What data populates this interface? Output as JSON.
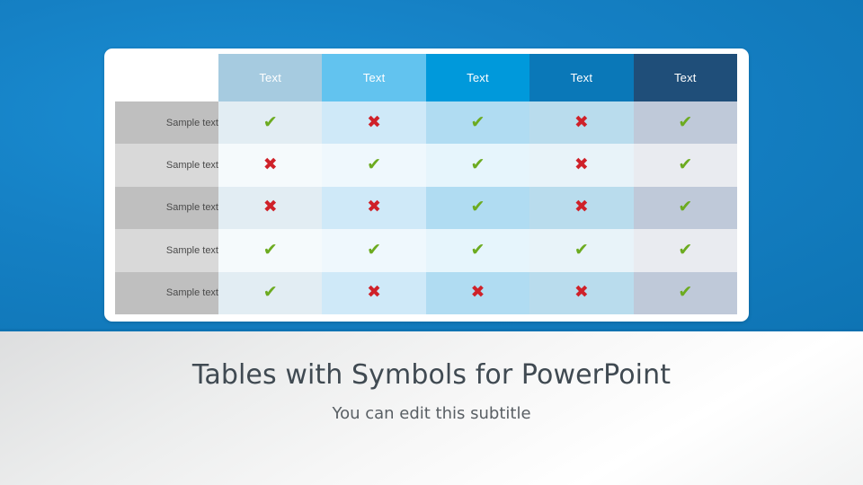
{
  "slide": {
    "title": "Tables with Symbols for PowerPoint",
    "subtitle": "You can edit this subtitle"
  },
  "colors": {
    "background_blue": "#1580c4",
    "background_light": "#f2f3f3",
    "card": "#ffffff",
    "check": "#6cab20",
    "cross": "#cf2129",
    "row_label_dark": "#bfbfbf",
    "row_label_light": "#d9d9d9",
    "title_text": "#404a52",
    "subtitle_text": "#595f64"
  },
  "table": {
    "corner_label": "",
    "columns": [
      {
        "label": "Text",
        "header_color": "#a6cbe0",
        "cell_odd": "#e2edf3",
        "cell_even": "#f5fafc"
      },
      {
        "label": "Text",
        "header_color": "#62c3ef",
        "cell_odd": "#cfe9f8",
        "cell_even": "#eff8fd"
      },
      {
        "label": "Text",
        "header_color": "#0099db",
        "cell_odd": "#b0dcf2",
        "cell_even": "#e6f5fc"
      },
      {
        "label": "Text",
        "header_color": "#0a78b8",
        "cell_odd": "#b9dced",
        "cell_even": "#e8f3f9"
      },
      {
        "label": "Text",
        "header_color": "#1f4e79",
        "cell_odd": "#bfc9d9",
        "cell_even": "#e9ebf0"
      }
    ],
    "rows": [
      {
        "label": "Sample text",
        "shade": "dark",
        "symbols": [
          "check",
          "cross",
          "check",
          "cross",
          "check"
        ]
      },
      {
        "label": "Sample text",
        "shade": "light",
        "symbols": [
          "cross",
          "check",
          "check",
          "cross",
          "check"
        ]
      },
      {
        "label": "Sample text",
        "shade": "dark",
        "symbols": [
          "cross",
          "cross",
          "check",
          "cross",
          "check"
        ]
      },
      {
        "label": "Sample text",
        "shade": "light",
        "symbols": [
          "check",
          "check",
          "check",
          "check",
          "check"
        ]
      },
      {
        "label": "Sample text",
        "shade": "dark",
        "symbols": [
          "check",
          "cross",
          "cross",
          "cross",
          "check"
        ]
      }
    ],
    "symbol_glyphs": {
      "check": "✔",
      "cross": "✖"
    }
  }
}
